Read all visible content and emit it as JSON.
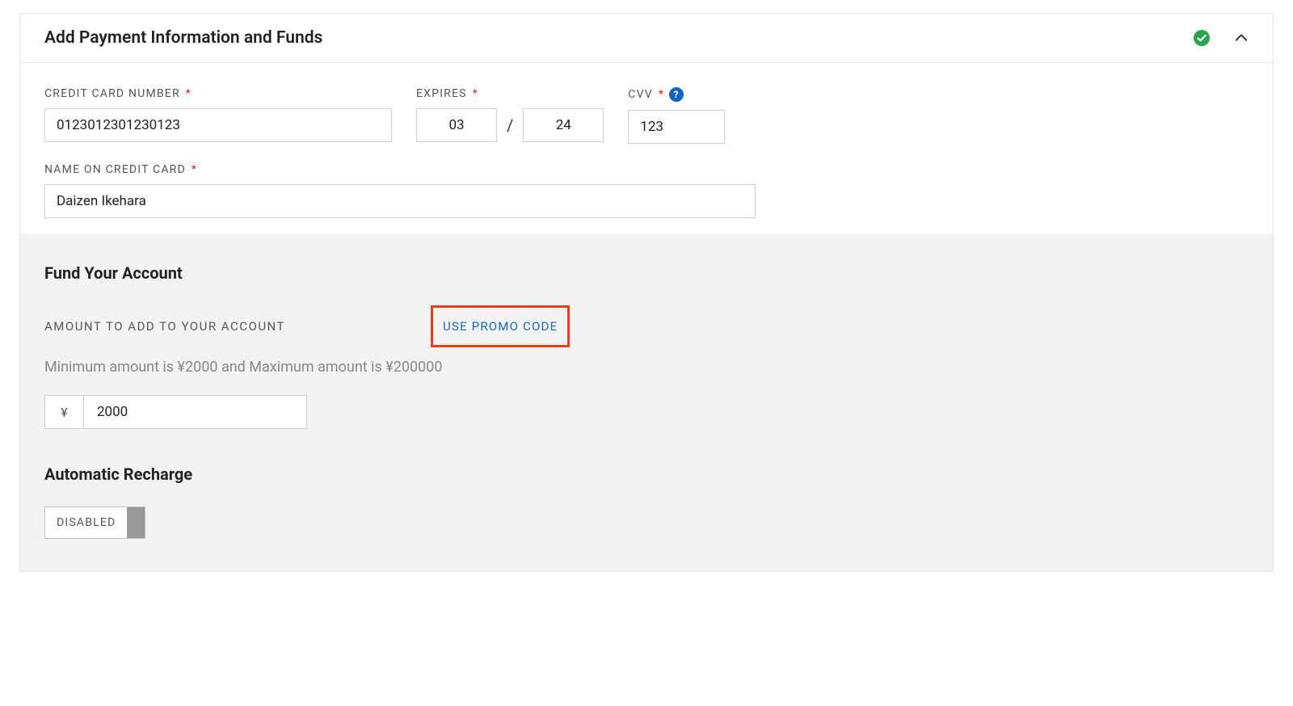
{
  "header": {
    "title": "Add Payment Information and Funds",
    "status": "complete"
  },
  "card": {
    "number_label": "CREDIT CARD NUMBER",
    "number_value": "0123012301230123",
    "expires_label": "EXPIRES",
    "exp_month": "03",
    "exp_year": "24",
    "exp_sep": "/",
    "cvv_label": "CVV",
    "cvv_value": "123",
    "name_label": "NAME ON CREDIT CARD",
    "name_value": "Daizen Ikehara"
  },
  "fund": {
    "title": "Fund Your Account",
    "amount_label": "AMOUNT TO ADD TO YOUR ACCOUNT",
    "promo_link": "USE PROMO CODE",
    "hint": "Minimum amount is ¥2000 and Maximum amount is ¥200000",
    "currency_symbol": "¥",
    "amount_value": "2000"
  },
  "auto": {
    "title": "Automatic Recharge",
    "toggle_label": "DISABLED",
    "enabled": false
  },
  "colors": {
    "accent": "#1565c0",
    "success": "#2ba24c",
    "error": "#e63e20"
  }
}
